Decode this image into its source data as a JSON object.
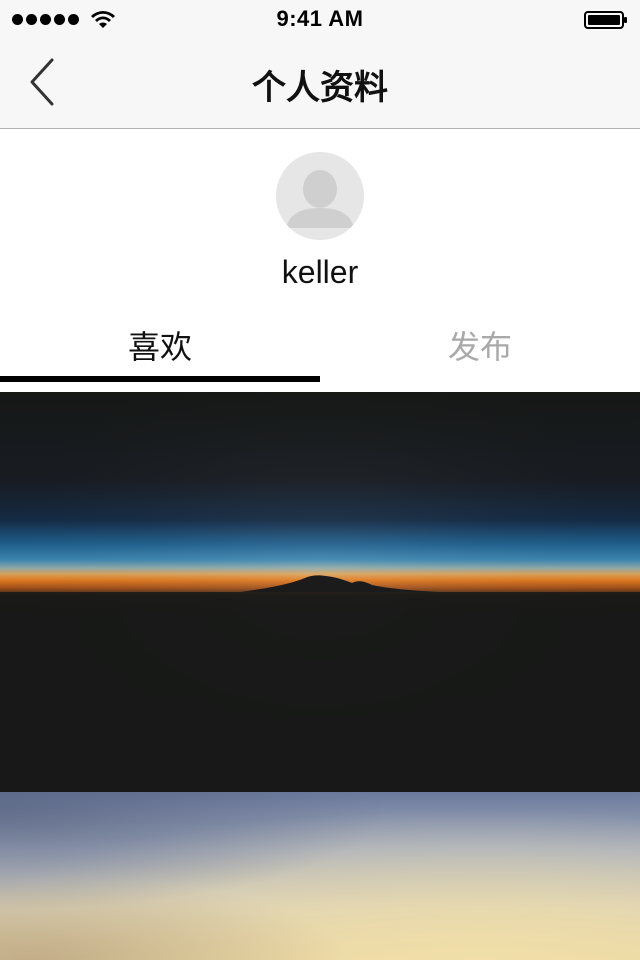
{
  "status_bar": {
    "time": "9:41 AM"
  },
  "nav": {
    "title": "个人资料",
    "back_icon": "chevron-left-icon"
  },
  "profile": {
    "username": "keller",
    "avatar_icon": "default-avatar-icon"
  },
  "tabs": [
    {
      "label": "喜欢",
      "selected": true
    },
    {
      "label": "发布",
      "selected": false
    }
  ],
  "colors": {
    "tab_active": "#111111",
    "tab_inactive": "#a9a9a9",
    "indicator": "#000000",
    "nav_background": "#f7f7f7"
  },
  "feed": [
    {
      "description": "sunset-horizon-photo"
    },
    {
      "description": "sky-gradient-photo"
    }
  ]
}
